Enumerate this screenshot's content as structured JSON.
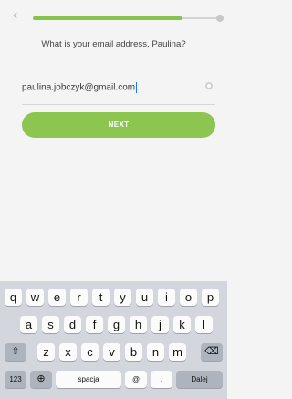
{
  "header": {
    "back_icon": "chevron-left-icon",
    "progress_fraction": 0.8
  },
  "prompt": {
    "question": "What is your email address, Paulina?"
  },
  "email_input": {
    "value": "paulina.jobczyk@gmail.com"
  },
  "primary_button": {
    "label": "NEXT"
  },
  "keyboard": {
    "row1": [
      "q",
      "w",
      "e",
      "r",
      "t",
      "y",
      "u",
      "i",
      "o",
      "p"
    ],
    "row2": [
      "a",
      "s",
      "d",
      "f",
      "g",
      "h",
      "j",
      "k",
      "l"
    ],
    "row3": [
      "z",
      "x",
      "c",
      "v",
      "b",
      "n",
      "m"
    ],
    "bottom": {
      "numbers": "123",
      "space": "spacja",
      "at": "@",
      "dot": ".",
      "done": "Dalej"
    }
  },
  "colors": {
    "accent_green": "#86c450",
    "background": "#f4f4f4",
    "keyboard_bg": "#d3d6dc"
  }
}
